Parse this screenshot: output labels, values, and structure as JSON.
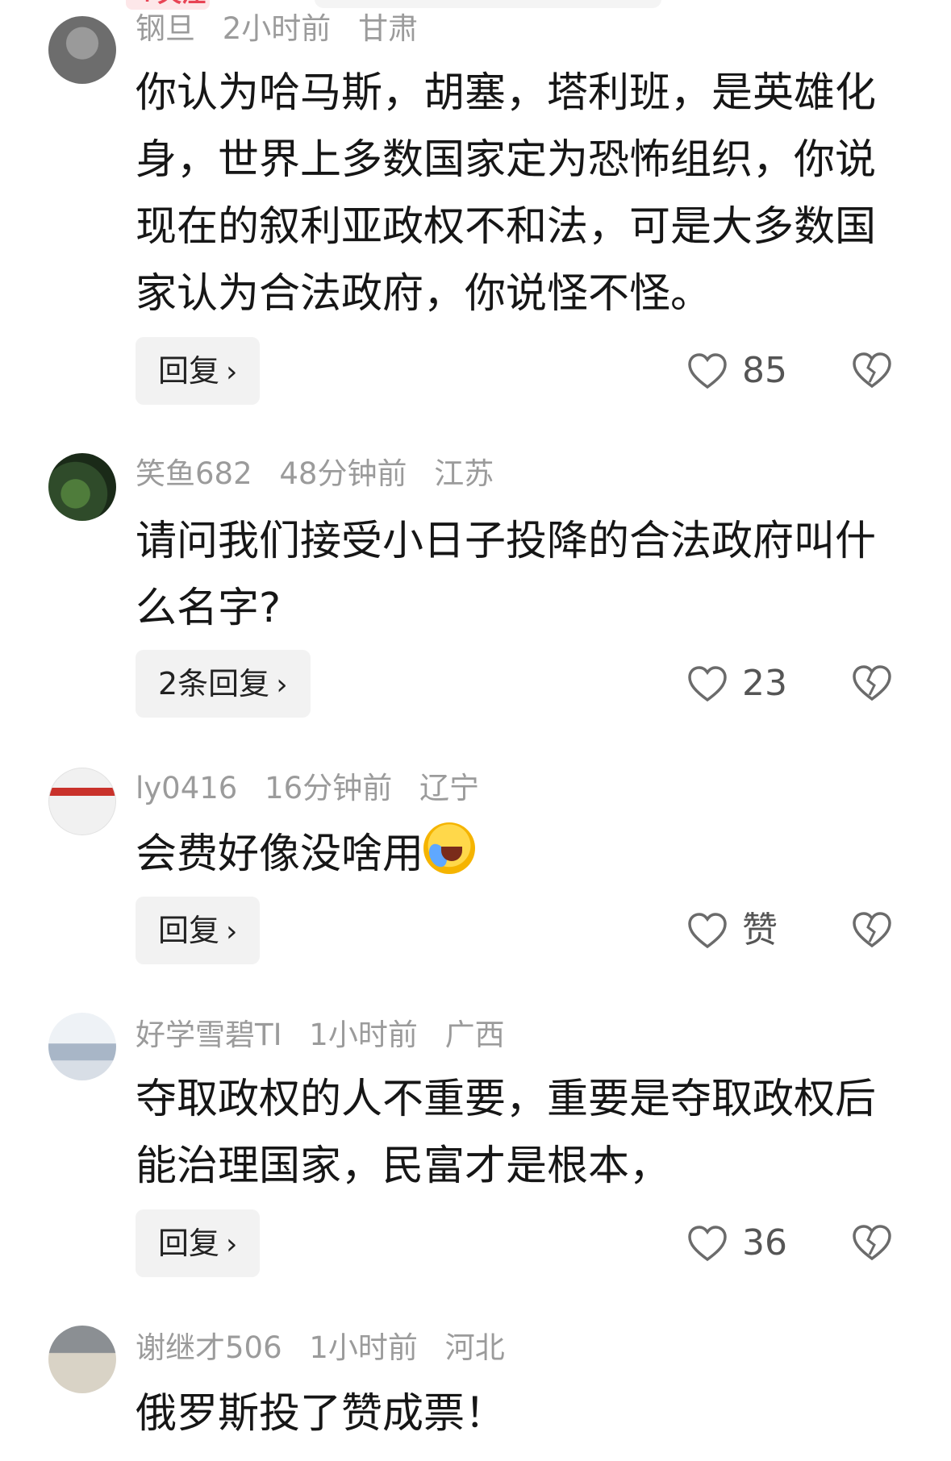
{
  "top": {
    "follow_tag": "+关注"
  },
  "comments": [
    {
      "username": "钢旦",
      "time": "2小时前",
      "location": "甘肃",
      "text": "你认为哈马斯，胡塞，塔利班，是英雄化身，世界上多数国家定为恐怖组织，你说现在的叙利亚政权不和法，可是大多数国家认为合法政府，你说怪不怪。",
      "reply_label": "回复",
      "likes": "85"
    },
    {
      "username": "笑鱼682",
      "time": "48分钟前",
      "location": "江苏",
      "text": "请问我们接受小日子投降的合法政府叫什么名字?",
      "reply_label": "2条回复",
      "likes": "23"
    },
    {
      "username": "ly0416",
      "time": "16分钟前",
      "location": "辽宁",
      "text": "会费好像没啥用",
      "emoji": "laughing-crying-emoji",
      "reply_label": "回复",
      "likes": "赞"
    },
    {
      "username": "好学雪碧TI",
      "time": "1小时前",
      "location": "广西",
      "text": "夺取政权的人不重要，重要是夺取政权后能治理国家，民富才是根本，",
      "reply_label": "回复",
      "likes": "36"
    },
    {
      "username": "谢继才506",
      "time": "1小时前",
      "location": "河北",
      "text": "俄罗斯投了赞成票！"
    }
  ],
  "colors": {
    "meta": "#9b9b9b",
    "text": "#161616",
    "reply_bg": "#f2f2f2",
    "accent": "#e84455"
  }
}
